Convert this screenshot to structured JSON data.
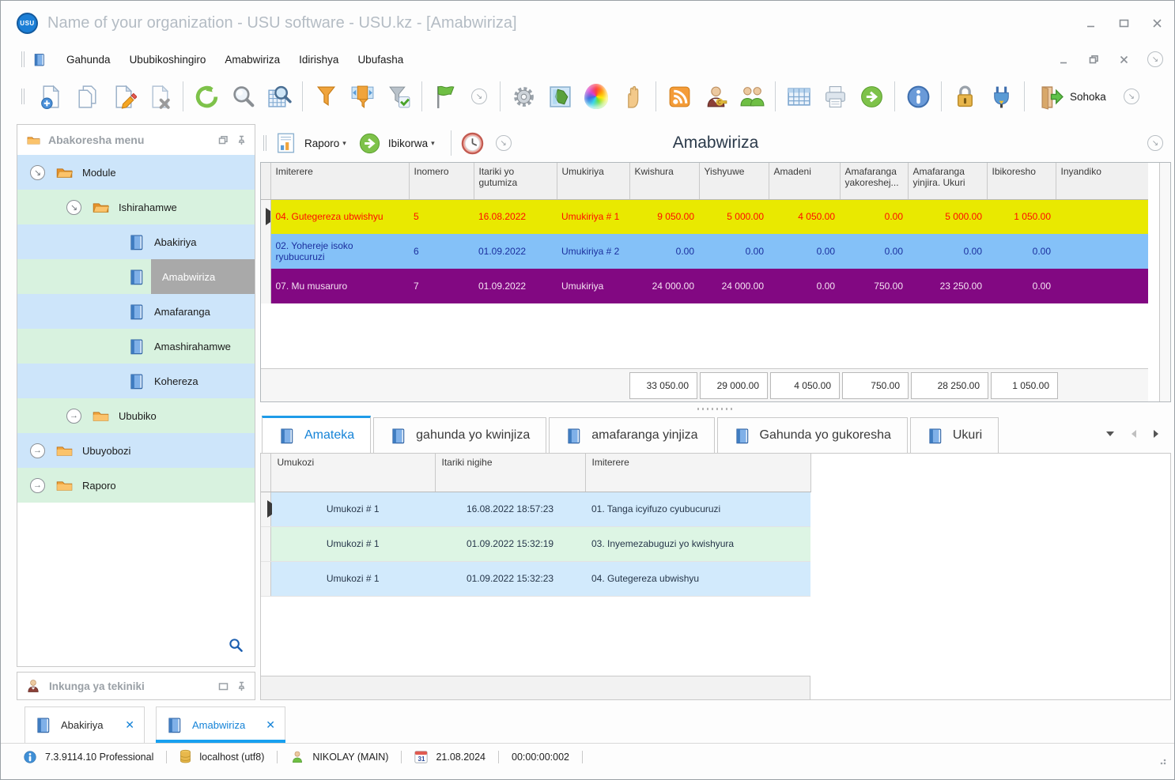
{
  "window": {
    "title": "Name of your organization - USU software - USU.kz - [Amabwiriza]",
    "logo_text": "USU"
  },
  "menu_bar": {
    "items": [
      "Gahunda",
      "Ububikoshingiro",
      "Amabwiriza",
      "Idirishya",
      "Ubufasha"
    ]
  },
  "toolbar": {
    "sohoka_label": "Sohoka"
  },
  "sidebar": {
    "header": "Abakoresha menu",
    "items": [
      {
        "label": "Module"
      },
      {
        "label": "Ishirahamwe"
      },
      {
        "label": "Abakiriya"
      },
      {
        "label": "Amabwiriza"
      },
      {
        "label": "Amafaranga"
      },
      {
        "label": "Amashirahamwe"
      },
      {
        "label": "Kohereza"
      },
      {
        "label": "Ububiko"
      },
      {
        "label": "Ubuyobozi"
      },
      {
        "label": "Raporo"
      }
    ],
    "support_header": "Inkunga ya tekiniki"
  },
  "detail_toolbar": {
    "raporo_label": "Raporo",
    "ibikorwa_label": "Ibikorwa",
    "title": "Amabwiriza"
  },
  "main_table": {
    "columns": [
      "Imiterere",
      "Inomero",
      "Itariki yo gutumiza",
      "Umukiriya",
      "Kwishura",
      "Yishyuwe",
      "Amadeni",
      "Amafaranga yakoreshej...",
      "Amafaranga yinjira. Ukuri",
      "Ibikoresho",
      "Inyandiko"
    ],
    "rows": [
      {
        "cells": [
          "04. Gutegereza ubwishyu",
          "5",
          "16.08.2022",
          "Umukiriya # 1",
          "9 050.00",
          "5 000.00",
          "4 050.00",
          "0.00",
          "5 000.00",
          "1 050.00",
          ""
        ]
      },
      {
        "cells": [
          "02. Yohereje isoko ryubucuruzi",
          "6",
          "01.09.2022",
          "Umukiriya # 2",
          "0.00",
          "0.00",
          "0.00",
          "0.00",
          "0.00",
          "0.00",
          ""
        ]
      },
      {
        "cells": [
          "07. Mu musaruro",
          "7",
          "01.09.2022",
          "Umukiriya",
          "24 000.00",
          "24 000.00",
          "0.00",
          "750.00",
          "23 250.00",
          "0.00",
          ""
        ]
      }
    ],
    "totals": [
      "33 050.00",
      "29 000.00",
      "4 050.00",
      "750.00",
      "28 250.00",
      "1 050.00"
    ]
  },
  "detail_tabs": {
    "tabs": [
      "Amateka",
      "gahunda yo kwinjiza",
      "amafaranga yinjiza",
      "Gahunda yo gukoresha",
      "Ukuri"
    ],
    "active_tab": "Amateka"
  },
  "history_table": {
    "columns": [
      "Umukozi",
      "Itariki nigihe",
      "Imiterere"
    ],
    "rows": [
      {
        "cells": [
          "Umukozi # 1",
          "16.08.2022 18:57:23",
          "01. Tanga icyifuzo cyubucuruzi"
        ]
      },
      {
        "cells": [
          "Umukozi # 1",
          "01.09.2022 15:32:19",
          "03. Inyemezabuguzi yo kwishyura"
        ]
      },
      {
        "cells": [
          "Umukozi # 1",
          "01.09.2022 15:32:23",
          "04. Gutegereza ubwishyu"
        ]
      }
    ]
  },
  "window_tabs": [
    {
      "label": "Abakiriya"
    },
    {
      "label": "Amabwiriza"
    }
  ],
  "status_bar": {
    "version": "7.3.9114.10 Professional",
    "database": "localhost (utf8)",
    "user": "NIKOLAY (MAIN)",
    "calendar_day": "31",
    "date": "21.08.2024",
    "timer": "00:00:00:002"
  },
  "colors": {
    "row_yellow": "#e9e900",
    "row_blue": "#84c1f8",
    "row_purple": "#820882",
    "accent_blue": "#1583d7",
    "stripe_blue": "#cde5fa",
    "stripe_green": "#d8f2df"
  }
}
